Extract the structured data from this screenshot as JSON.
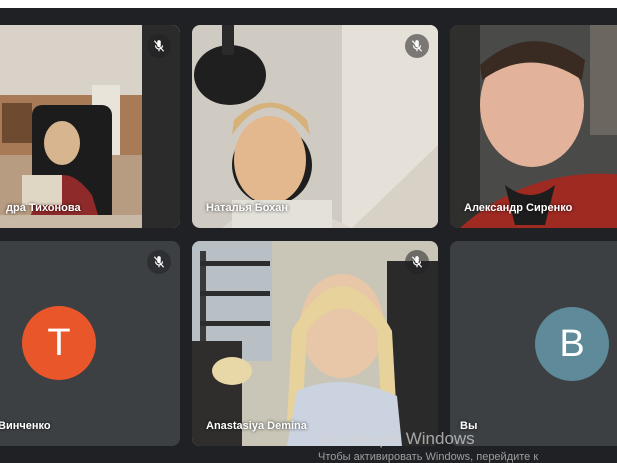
{
  "participants": [
    {
      "name": "дра Тихонова",
      "muted": true
    },
    {
      "name": "Наталья Бохан",
      "muted": true
    },
    {
      "name": "Александр Сиренко",
      "muted": false
    },
    {
      "name": "Винченко",
      "muted": true,
      "avatar_letter": "T",
      "avatar_color": "#e8562a"
    },
    {
      "name": "Anastasiya Demina",
      "muted": true
    },
    {
      "name": "Вы",
      "muted": false,
      "avatar_letter": "B",
      "avatar_color": "#5f8a99"
    }
  ],
  "icons": {
    "mute": "mic-off-icon"
  },
  "colors": {
    "background": "#202124",
    "tile": "#3c4043"
  },
  "watermark": {
    "title": "Активация Windows",
    "subtitle": "Чтобы активировать Windows, перейдите к"
  }
}
